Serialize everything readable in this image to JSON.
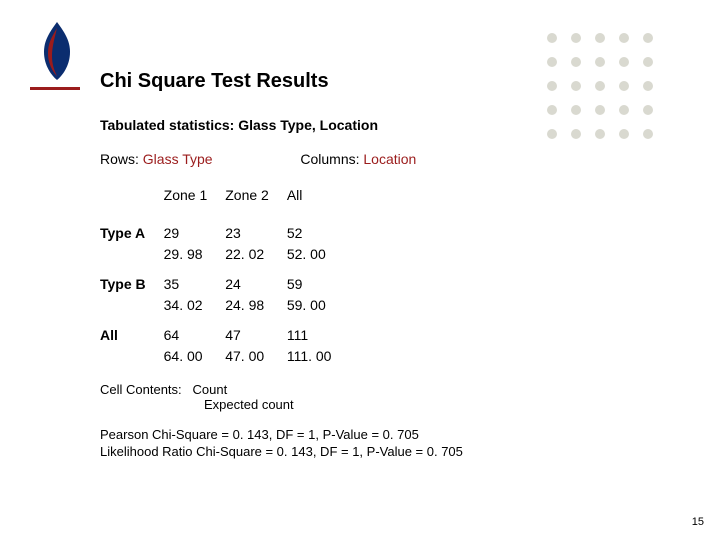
{
  "title": "Chi Square Test Results",
  "tab_line": "Tabulated statistics: Glass Type, Location",
  "rows_label": "Rows: ",
  "rows_value": "Glass Type",
  "cols_label": "Columns: ",
  "cols_value": "Location",
  "headers": {
    "c1": "Zone 1",
    "c2": "Zone 2",
    "c3": "All"
  },
  "rows": {
    "r0": {
      "label": "Type A",
      "c1a": "29",
      "c1b": "29. 98",
      "c2a": "23",
      "c2b": "22. 02",
      "c3a": "52",
      "c3b": "52. 00"
    },
    "r1": {
      "label": "Type B",
      "c1a": "35",
      "c1b": "34. 02",
      "c2a": "24",
      "c2b": "24. 98",
      "c3a": "59",
      "c3b": "59. 00"
    },
    "r2": {
      "label": "All",
      "c1a": "64",
      "c1b": "64. 00",
      "c2a": "47",
      "c2b": "47. 00",
      "c3a": "111",
      "c3b": "111. 00"
    }
  },
  "cell_contents_label": "Cell Contents:",
  "cell_contents_line1": "Count",
  "cell_contents_line2": "Expected count",
  "pearson": "Pearson Chi-Square = 0. 143, DF = 1, P-Value = 0. 705",
  "likelihood": "Likelihood Ratio Chi-Square = 0. 143, DF = 1, P-Value = 0. 705",
  "page_number": "15",
  "chart_data": {
    "type": "table",
    "title": "Tabulated statistics: Glass Type, Location",
    "row_variable": "Glass Type",
    "column_variable": "Location",
    "columns": [
      "Zone 1",
      "Zone 2",
      "All"
    ],
    "rows": [
      "Type A",
      "Type B",
      "All"
    ],
    "observed": [
      [
        29,
        23,
        52
      ],
      [
        35,
        24,
        59
      ],
      [
        64,
        47,
        111
      ]
    ],
    "expected": [
      [
        29.98,
        22.02,
        52.0
      ],
      [
        34.02,
        24.98,
        59.0
      ],
      [
        64.0,
        47.0,
        111.0
      ]
    ],
    "pearson_chi_square": 0.143,
    "pearson_df": 1,
    "pearson_p_value": 0.705,
    "likelihood_ratio_chi_square": 0.143,
    "likelihood_ratio_df": 1,
    "likelihood_ratio_p_value": 0.705
  }
}
